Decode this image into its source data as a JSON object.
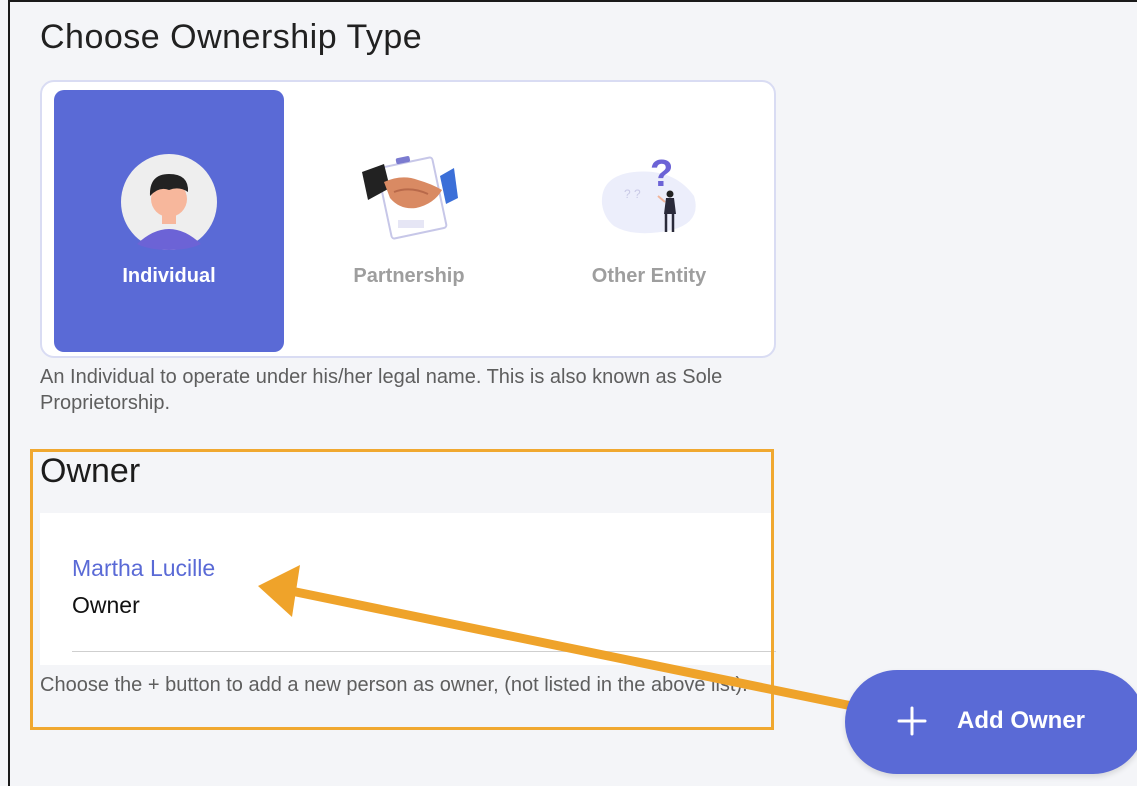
{
  "page": {
    "title": "Choose Ownership Type"
  },
  "ownership": {
    "options": [
      {
        "label": "Individual",
        "icon": "individual-avatar-icon",
        "selected": true
      },
      {
        "label": "Partnership",
        "icon": "handshake-icon",
        "selected": false
      },
      {
        "label": "Other Entity",
        "icon": "question-person-icon",
        "selected": false
      }
    ],
    "description": "An Individual to operate under his/her legal name. This is also known as Sole Proprietorship."
  },
  "owners": {
    "section_title": "Owner",
    "list": [
      {
        "name": "Martha Lucille",
        "role": "Owner"
      }
    ],
    "help": "Choose the + button to add a new person as owner, (not listed in the above list)."
  },
  "fab": {
    "label": "Add Owner",
    "icon": "plus-icon"
  },
  "colors": {
    "accent": "#5a6ad6",
    "highlight_border": "#f0a830",
    "background": "#f4f5f8"
  }
}
